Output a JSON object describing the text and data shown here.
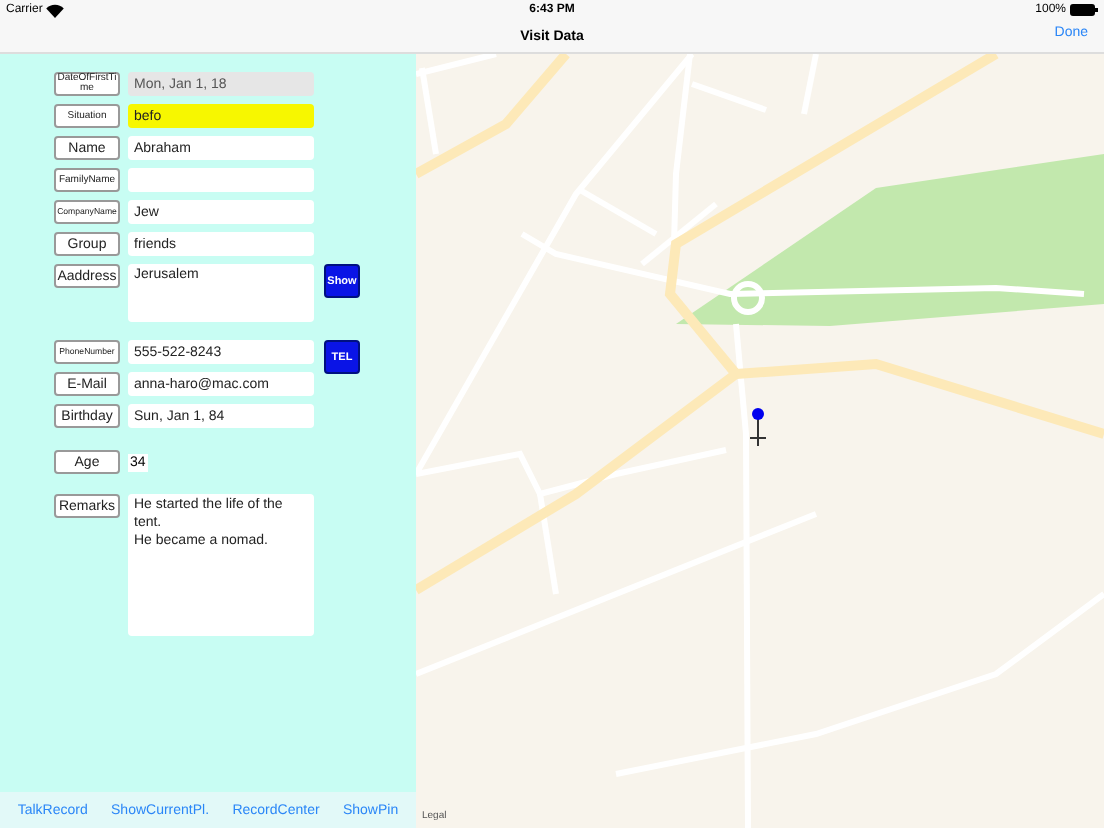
{
  "status_bar": {
    "carrier": "Carrier",
    "time": "6:43 PM",
    "battery": "100%"
  },
  "nav_bar": {
    "title": "Visit Data",
    "done": "Done"
  },
  "form": [
    {
      "label": "DateOfFirstTime",
      "kind": "field",
      "value": "Mon, Jan 1, 18",
      "highlighted": false,
      "disabled": true
    },
    {
      "label": "Situation",
      "kind": "field",
      "value": "befo",
      "highlighted": true,
      "disabled": false
    },
    {
      "label": "Name",
      "kind": "field",
      "value": "Abraham",
      "highlighted": false,
      "disabled": false
    },
    {
      "label": "FamilyName",
      "kind": "field",
      "highlighted": false,
      "disabled": false
    },
    {
      "label": "CompanyName",
      "kind": "field",
      "value": "Jew",
      "highlighted": false,
      "disabled": false
    },
    {
      "label": "Group",
      "kind": "field",
      "value": "friends",
      "highlighted": false,
      "disabled": false
    },
    {
      "label": "Aaddress",
      "kind": "area",
      "value": "Jerusalem",
      "highlighted": false,
      "disabled": false,
      "action": "Show"
    },
    {
      "label": "PhoneNumber",
      "kind": "field",
      "value": "555-522-8243",
      "highlighted": false,
      "disabled": false,
      "action": "TEL"
    },
    {
      "label": "E-Mail",
      "kind": "field",
      "value": "anna-haro@mac.com",
      "highlighted": false,
      "disabled": false
    },
    {
      "label": "Birthday",
      "kind": "field",
      "value": "Sun, Jan 1, 84",
      "highlighted": false,
      "disabled": false
    },
    {
      "label": "Age",
      "kind": "plain",
      "value": "34",
      "highlighted": false,
      "disabled": false
    },
    {
      "label": "Remarks",
      "kind": "remarks",
      "value": "He started the life of the tent.\nHe became a nomad.",
      "highlighted": false,
      "disabled": false
    }
  ],
  "toolbar": [
    "TalkRecord",
    "ShowCurrentPl.",
    "RecordCenter",
    "ShowPin"
  ],
  "map": {
    "legal": "Legal"
  }
}
